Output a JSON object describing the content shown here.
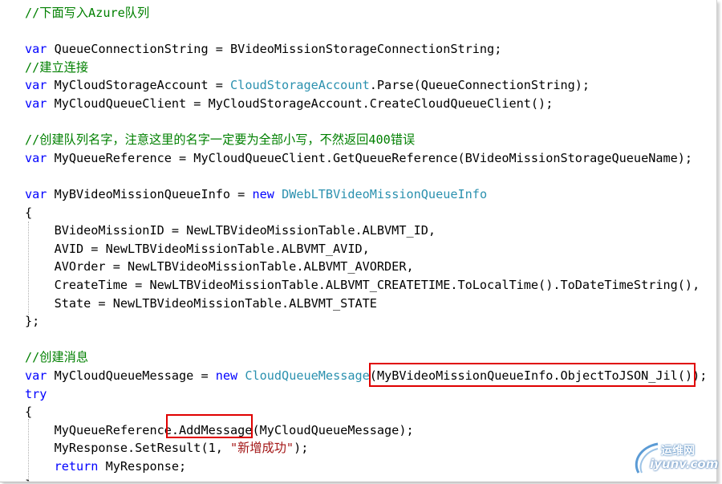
{
  "editor": {
    "lines": [
      {
        "tokens": [
          {
            "t": "//下面写入Azure队列",
            "c": "cm"
          }
        ]
      },
      {
        "tokens": []
      },
      {
        "tokens": [
          {
            "t": "var",
            "c": "kw"
          },
          {
            "t": " QueueConnectionString = BVideoMissionStorageConnectionString;",
            "c": ""
          }
        ]
      },
      {
        "tokens": [
          {
            "t": "//建立连接",
            "c": "cm"
          }
        ]
      },
      {
        "tokens": [
          {
            "t": "var",
            "c": "kw"
          },
          {
            "t": " MyCloudStorageAccount = ",
            "c": ""
          },
          {
            "t": "CloudStorageAccount",
            "c": "ty"
          },
          {
            "t": ".Parse(QueueConnectionString);",
            "c": ""
          }
        ]
      },
      {
        "tokens": [
          {
            "t": "var",
            "c": "kw"
          },
          {
            "t": " MyCloudQueueClient = MyCloudStorageAccount.CreateCloudQueueClient();",
            "c": ""
          }
        ]
      },
      {
        "tokens": []
      },
      {
        "tokens": [
          {
            "t": "//创建队列名字，注意这里的名字一定要为全部小写，不然返回400错误",
            "c": "cm"
          }
        ]
      },
      {
        "tokens": [
          {
            "t": "var",
            "c": "kw"
          },
          {
            "t": " MyQueueReference = MyCloudQueueClient.GetQueueReference(BVideoMissionStorageQueueName);",
            "c": ""
          }
        ]
      },
      {
        "tokens": []
      },
      {
        "tokens": [
          {
            "t": "var",
            "c": "kw"
          },
          {
            "t": " MyBVideoMissionQueueInfo = ",
            "c": ""
          },
          {
            "t": "new",
            "c": "kw"
          },
          {
            "t": " ",
            "c": ""
          },
          {
            "t": "DWebLTBVideoMissionQueueInfo",
            "c": "ty"
          }
        ]
      },
      {
        "tokens": [
          {
            "t": "{",
            "c": ""
          }
        ]
      },
      {
        "tokens": [
          {
            "t": "    BVideoMissionID = NewLTBVideoMissionTable.ALBVMT_ID,",
            "c": ""
          }
        ]
      },
      {
        "tokens": [
          {
            "t": "    AVID = NewLTBVideoMissionTable.ALBVMT_AVID,",
            "c": ""
          }
        ]
      },
      {
        "tokens": [
          {
            "t": "    AVOrder = NewLTBVideoMissionTable.ALBVMT_AVORDER,",
            "c": ""
          }
        ]
      },
      {
        "tokens": [
          {
            "t": "    CreateTime = NewLTBVideoMissionTable.ALBVMT_CREATETIME.ToLocalTime().ToDateTimeString(),",
            "c": ""
          }
        ]
      },
      {
        "tokens": [
          {
            "t": "    State = NewLTBVideoMissionTable.ALBVMT_STATE",
            "c": ""
          }
        ]
      },
      {
        "tokens": [
          {
            "t": "};",
            "c": ""
          }
        ]
      },
      {
        "tokens": []
      },
      {
        "tokens": [
          {
            "t": "//创建消息",
            "c": "cm"
          }
        ]
      },
      {
        "tokens": [
          {
            "t": "var",
            "c": "kw"
          },
          {
            "t": " MyCloudQueueMessage = ",
            "c": ""
          },
          {
            "t": "new",
            "c": "kw"
          },
          {
            "t": " ",
            "c": ""
          },
          {
            "t": "CloudQueueMessage",
            "c": "ty"
          },
          {
            "t": "(MyBVideoMissionQueueInfo.ObjectToJSON_Jil());",
            "c": ""
          }
        ]
      },
      {
        "tokens": [
          {
            "t": "try",
            "c": "kw"
          }
        ]
      },
      {
        "tokens": [
          {
            "t": "{",
            "c": ""
          }
        ]
      },
      {
        "tokens": [
          {
            "t": "    MyQueueReference.AddMessage(MyCloudQueueMessage);",
            "c": ""
          }
        ]
      },
      {
        "tokens": [
          {
            "t": "    MyResponse.SetResult(1, ",
            "c": ""
          },
          {
            "t": "\"新增成功\"",
            "c": "st"
          },
          {
            "t": ");",
            "c": ""
          }
        ]
      },
      {
        "tokens": [
          {
            "t": "    ",
            "c": ""
          },
          {
            "t": "return",
            "c": "kw"
          },
          {
            "t": " MyResponse;",
            "c": ""
          }
        ]
      },
      {
        "tokens": [
          {
            "t": "}",
            "c": ""
          }
        ]
      }
    ]
  },
  "colors": {
    "keyword": "#0000ff",
    "type": "#2b91af",
    "comment": "#008000",
    "string": "#a31515",
    "highlight_box": "#e00000"
  },
  "watermark": {
    "cn": "运维网",
    "en": "iyunv.com"
  }
}
